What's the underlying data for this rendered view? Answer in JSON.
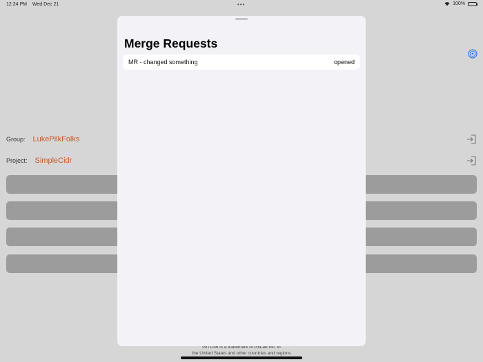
{
  "status_bar": {
    "time": "12:24 PM",
    "date": "Wed Dec 21",
    "battery": "100%"
  },
  "main": {
    "group_label": "Group:",
    "group_value": "LukePilkFolks",
    "project_label": "Project:",
    "project_value": "SimpleCidr",
    "footer_line1": "GITLAB is a trademark of GitLab Inc. in",
    "footer_line2": "the United States and other countries and regions"
  },
  "sheet": {
    "title": "Merge Requests",
    "items": [
      {
        "title": "MR - changed something",
        "state": "opened"
      }
    ]
  },
  "colors": {
    "accent": "#c45a2a",
    "tint_blue": "#2f7de1"
  }
}
